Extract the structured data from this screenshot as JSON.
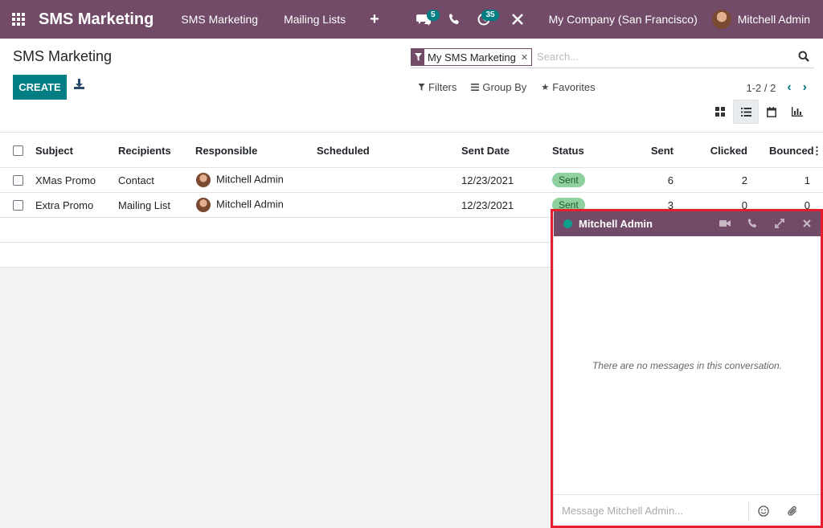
{
  "navbar": {
    "app_name": "SMS Marketing",
    "menu": [
      "SMS Marketing",
      "Mailing Lists"
    ],
    "messages_badge": "5",
    "activities_badge": "35",
    "company": "My Company (San Francisco)",
    "user": "Mitchell Admin",
    "color": "#714b67"
  },
  "control_panel": {
    "title": "SMS Marketing",
    "create_label": "CREATE",
    "search_facet": "My SMS Marketing",
    "search_placeholder": "Search...",
    "filters_label": "Filters",
    "group_by_label": "Group By",
    "favorites_label": "Favorites",
    "pager": "1-2 / 2",
    "active_view": "list",
    "accent_color": "#017e84"
  },
  "table": {
    "headers": [
      "Subject",
      "Recipients",
      "Responsible",
      "Scheduled",
      "Sent Date",
      "Status",
      "Sent",
      "Clicked",
      "Bounced"
    ],
    "rows": [
      {
        "subject": "XMas Promo",
        "recipients": "Contact",
        "responsible": "Mitchell Admin",
        "scheduled": "",
        "sent_date": "12/23/2021",
        "status": "Sent",
        "sent": "6",
        "clicked": "2",
        "bounced": "1"
      },
      {
        "subject": "Extra Promo",
        "recipients": "Mailing List",
        "responsible": "Mitchell Admin",
        "scheduled": "",
        "sent_date": "12/23/2021",
        "status": "Sent",
        "sent": "3",
        "clicked": "0",
        "bounced": "0"
      }
    ]
  },
  "chat": {
    "title": "Mitchell Admin",
    "empty_text": "There are no messages in this conversation.",
    "placeholder": "Message Mitchell Admin...",
    "highlight_color": "#e41e2c"
  }
}
